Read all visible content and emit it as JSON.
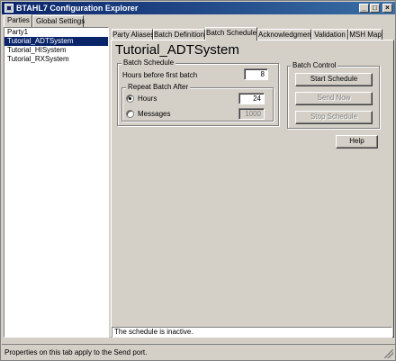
{
  "window": {
    "title": "BTAHL7 Configuration Explorer",
    "min_glyph": "_",
    "max_glyph": "□",
    "close_glyph": "×"
  },
  "left_tabs": [
    {
      "label": "Parties",
      "active": true
    },
    {
      "label": "Global Settings",
      "active": false
    }
  ],
  "parties": [
    {
      "label": "Party1",
      "selected": false
    },
    {
      "label": "Tutorial_ADTSystem",
      "selected": true
    },
    {
      "label": "Tutorial_HISystem",
      "selected": false
    },
    {
      "label": "Tutorial_RXSystem",
      "selected": false
    }
  ],
  "right_tabs": [
    {
      "label": "Party Aliases",
      "active": false
    },
    {
      "label": "Batch Definition",
      "active": false
    },
    {
      "label": "Batch Schedule",
      "active": true
    },
    {
      "label": "Acknowledgment",
      "active": false
    },
    {
      "label": "Validation",
      "active": false
    },
    {
      "label": "MSH Map",
      "active": false
    }
  ],
  "system_name": "Tutorial_ADTSystem",
  "batch_schedule": {
    "group_label": "Batch Schedule",
    "hours_before_label": "Hours before first batch",
    "hours_before_value": "8",
    "repeat_label": "Repeat Batch After",
    "hours_option_label": "Hours",
    "hours_option_value": "24",
    "hours_checked": true,
    "messages_option_label": "Messages",
    "messages_option_value": "1000",
    "messages_checked": false
  },
  "batch_control": {
    "group_label": "Batch Control",
    "start_label": "Start Schedule",
    "send_now_label": "Send Now",
    "stop_label": "Stop Schedule"
  },
  "help_label": "Help",
  "status_message": "The schedule is inactive.",
  "status_bar_text": "Properties on this tab apply to the Send port.",
  "colors": {
    "face": "#d4d0c8",
    "selection": "#0a246a",
    "title_start": "#0a246a",
    "title_end": "#3a6ea5"
  }
}
